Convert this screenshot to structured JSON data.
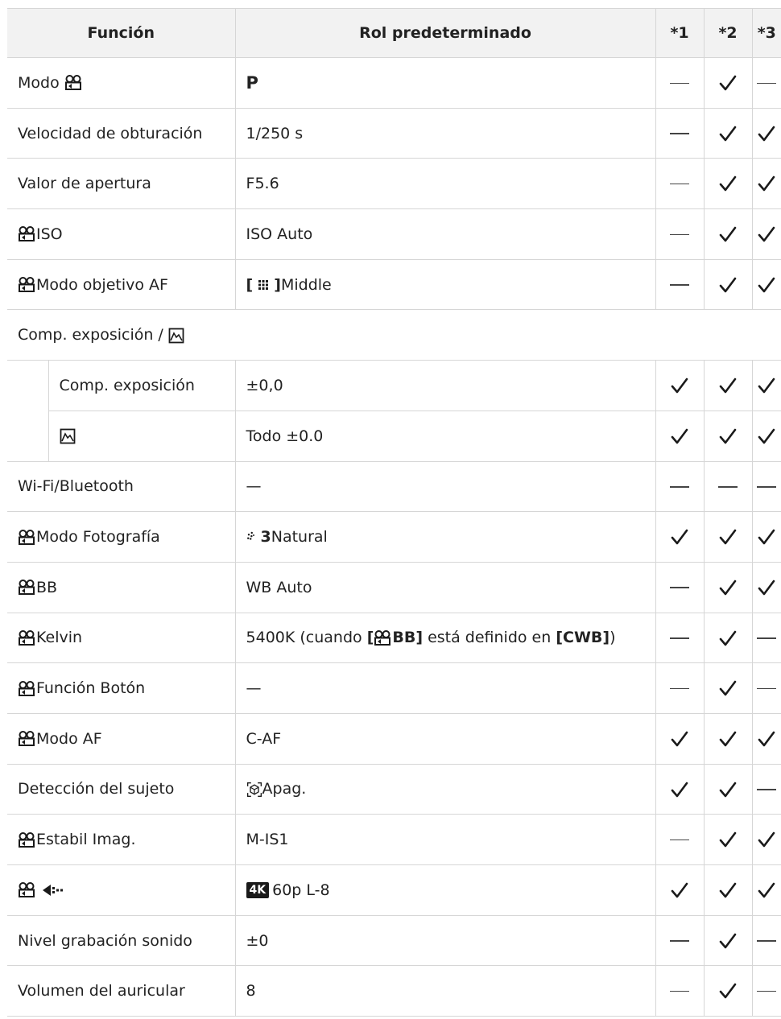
{
  "header": {
    "funcion": "Función",
    "rol": "Rol predeterminado",
    "c1": "*1",
    "c2": "*2",
    "c3": "*3"
  },
  "rows": [
    {
      "funcion": "Modo",
      "rol": "P",
      "c1": "dash",
      "c2": "check",
      "c3": "dash"
    },
    {
      "funcion": "Velocidad de obturación",
      "rol": "1/250 s",
      "c1": "dash",
      "c2": "check",
      "c3": "check"
    },
    {
      "funcion": "Valor de apertura",
      "rol": "F5.6",
      "c1": "dash",
      "c2": "check",
      "c3": "check"
    },
    {
      "funcion": "ISO",
      "rol": "ISO Auto",
      "c1": "dash",
      "c2": "check",
      "c3": "check"
    },
    {
      "funcion": "Modo objetivo AF",
      "rol_bracket_l": "[",
      "rol_bracket_r": "]",
      "rol": "Middle",
      "c1": "dash",
      "c2": "check",
      "c3": "check"
    },
    {
      "funcion": "Comp. exposición /"
    },
    {
      "funcion": "Comp. exposición",
      "rol": "±0,0",
      "c1": "check",
      "c2": "check",
      "c3": "check"
    },
    {
      "funcion": "",
      "rol": "Todo ±0.0",
      "c1": "check",
      "c2": "check",
      "c3": "check"
    },
    {
      "funcion": "Wi-Fi/Bluetooth",
      "rol": "—",
      "c1": "dash",
      "c2": "dash",
      "c3": "dash"
    },
    {
      "funcion": "Modo Fotografía",
      "rol_prefix": "3",
      "rol": "Natural",
      "c1": "check",
      "c2": "check",
      "c3": "check"
    },
    {
      "funcion": "BB",
      "rol": "WB Auto",
      "c1": "dash",
      "c2": "check",
      "c3": "check"
    },
    {
      "funcion": "Kelvin",
      "rol_a": "5400K (cuando ",
      "rol_b": "[",
      "rol_c": "BB]",
      "rol_d": " está definido en ",
      "rol_e": "[CWB]",
      "rol_f": ")",
      "c1": "dash",
      "c2": "check",
      "c3": "dash"
    },
    {
      "funcion": "Función Botón",
      "rol": "—",
      "c1": "dash",
      "c2": "check",
      "c3": "dash"
    },
    {
      "funcion": "Modo AF",
      "rol": "C-AF",
      "c1": "check",
      "c2": "check",
      "c3": "check"
    },
    {
      "funcion": "Detección del sujeto",
      "rol": "Apag.",
      "c1": "check",
      "c2": "check",
      "c3": "dash"
    },
    {
      "funcion": "Estabil Imag.",
      "rol": "M-IS1",
      "c1": "dash",
      "c2": "check",
      "c3": "check"
    },
    {
      "funcion": "",
      "rol_badge": "4K",
      "rol": "60p L-8",
      "c1": "check",
      "c2": "check",
      "c3": "check"
    },
    {
      "funcion": "Nivel grabación sonido",
      "rol": "±0",
      "c1": "dash",
      "c2": "check",
      "c3": "dash"
    },
    {
      "funcion": "Volumen del auricular",
      "rol": "8",
      "c1": "dash",
      "c2": "check",
      "c3": "dash"
    }
  ]
}
